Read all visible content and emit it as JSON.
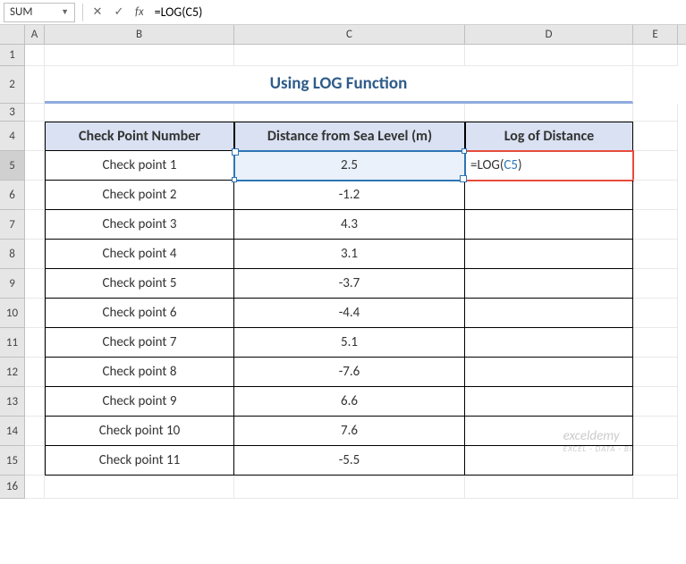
{
  "name_box": "SUM",
  "formula_bar": "=LOG(C5)",
  "fx_label": "fx",
  "columns": [
    "A",
    "B",
    "C",
    "D",
    "E"
  ],
  "rows": [
    "1",
    "2",
    "3",
    "4",
    "5",
    "6",
    "7",
    "8",
    "9",
    "10",
    "11",
    "12",
    "13",
    "14",
    "15",
    "16"
  ],
  "title": "Using LOG Function",
  "headers": {
    "b": "Check Point Number",
    "c": "Distance from Sea Level (m)",
    "d": "Log of Distance"
  },
  "data": [
    {
      "name": "Check point 1",
      "dist": "2.5",
      "log": "=LOG(C5)"
    },
    {
      "name": "Check point 2",
      "dist": "-1.2",
      "log": ""
    },
    {
      "name": "Check point 3",
      "dist": "4.3",
      "log": ""
    },
    {
      "name": "Check point 4",
      "dist": "3.1",
      "log": ""
    },
    {
      "name": "Check point 5",
      "dist": "-3.7",
      "log": ""
    },
    {
      "name": "Check point 6",
      "dist": "-4.4",
      "log": ""
    },
    {
      "name": "Check point 7",
      "dist": "5.1",
      "log": ""
    },
    {
      "name": "Check point 8",
      "dist": "-7.6",
      "log": ""
    },
    {
      "name": "Check point 9",
      "dist": "6.6",
      "log": ""
    },
    {
      "name": "Check point 10",
      "dist": "7.6",
      "log": ""
    },
    {
      "name": "Check point 11",
      "dist": "-5.5",
      "log": ""
    }
  ],
  "formula_cell": {
    "prefix": "=LOG(",
    "ref": "C5",
    "suffix": ")"
  },
  "watermark": {
    "main": "exceldemy",
    "sub": "EXCEL · DATA · BI"
  }
}
